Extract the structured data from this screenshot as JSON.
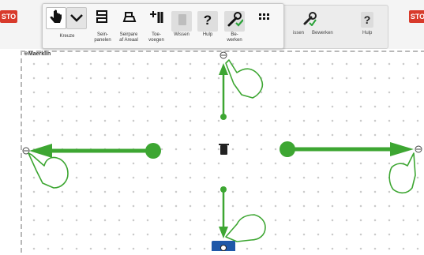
{
  "buttons": {
    "stop_left": "STO",
    "stop_right": "STO"
  },
  "toolbar": {
    "tools": [
      {
        "label": "Kreuze"
      },
      {
        "label": "Sein-\npanelen"
      },
      {
        "label": "Seirpare\naf Areaal"
      },
      {
        "label": "Toe-\nvoegen"
      },
      {
        "label": "Wissen"
      },
      {
        "label": "Hulp"
      },
      {
        "label": "Be-\nwerken"
      }
    ]
  },
  "bg_toolbar": {
    "labels": [
      "issen",
      "Bewerken",
      "Hulp"
    ]
  },
  "canvas": {
    "label": "Maerklin"
  },
  "colors": {
    "arrow": "#3da632",
    "stop": "#d83a2b",
    "handle": "#1f58a8"
  },
  "icons": [
    "hand-pointer-icon",
    "chevron-down-icon",
    "signal-icon",
    "signal-area-icon",
    "add-icon",
    "trash-icon",
    "help-icon",
    "wrench-icon",
    "grid-icon",
    "trash-icon",
    "resize-handle-icon"
  ]
}
